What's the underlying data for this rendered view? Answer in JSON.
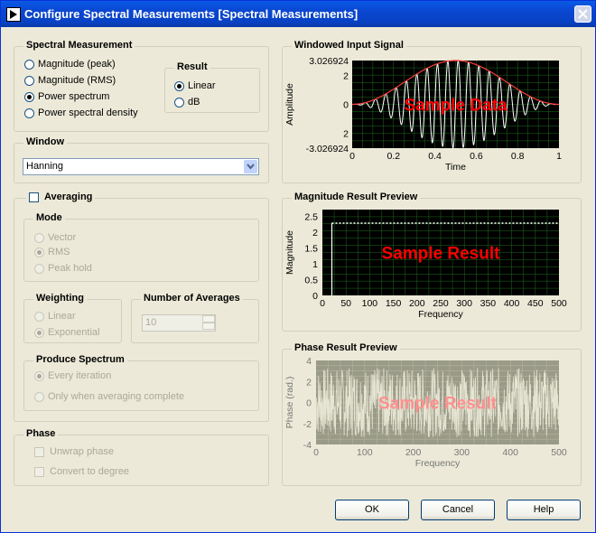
{
  "window": {
    "title": "Configure Spectral Measurements [Spectral Measurements]"
  },
  "spectral_measurement": {
    "label": "Spectral Measurement",
    "options": [
      "Magnitude (peak)",
      "Magnitude (RMS)",
      "Power spectrum",
      "Power spectral density"
    ],
    "selected": "Power spectrum"
  },
  "result": {
    "label": "Result",
    "options": [
      "Linear",
      "dB"
    ],
    "selected": "Linear"
  },
  "window_group": {
    "label": "Window",
    "value": "Hanning"
  },
  "averaging": {
    "label": "Averaging",
    "checked": false,
    "mode": {
      "label": "Mode",
      "options": [
        "Vector",
        "RMS",
        "Peak hold"
      ],
      "selected": "RMS"
    },
    "weighting": {
      "label": "Weighting",
      "options": [
        "Linear",
        "Exponential"
      ],
      "selected": "Exponential"
    },
    "number_of_averages": {
      "label": "Number of Averages",
      "value": "10"
    },
    "produce_spectrum": {
      "label": "Produce Spectrum",
      "options": [
        "Every iteration",
        "Only when averaging complete"
      ],
      "selected": "Every iteration"
    }
  },
  "phase": {
    "label": "Phase",
    "unwrap_label": "Unwrap phase",
    "convert_label": "Convert to degree"
  },
  "buttons": {
    "ok": "OK",
    "cancel": "Cancel",
    "help": "Help"
  },
  "colors": {
    "plot_bg": "#000000",
    "grid": "#1f6b1f",
    "overlay": "#ff0000",
    "envelope": "#ff3b3b",
    "disabled_bg": "#9a9a88"
  },
  "chart_data": [
    {
      "type": "line",
      "title": "Windowed Input Signal",
      "overlay_text": "Sample Data",
      "xlabel": "Time",
      "ylabel": "Amplitude",
      "x_ticks": [
        "0",
        "0.2",
        "0.4",
        "0.6",
        "0.8",
        "1"
      ],
      "y_ticks": [
        "3.026924",
        "2",
        "0",
        "2",
        "-3.026924"
      ],
      "xlim": [
        0,
        1
      ],
      "ylim": [
        -3.026924,
        3.026924
      ],
      "series": [
        {
          "signal": "sine",
          "amplitude": 3.026924,
          "cycles": 20,
          "window": "Hanning"
        }
      ]
    },
    {
      "type": "line",
      "title": "Magnitude Result Preview",
      "overlay_text": "Sample Result",
      "xlabel": "Frequency",
      "ylabel": "Magnitude",
      "x_ticks": [
        "0",
        "50",
        "100",
        "150",
        "200",
        "250",
        "300",
        "350",
        "400",
        "450",
        "500"
      ],
      "y_ticks": [
        "2.5",
        "2",
        "1.5",
        "1",
        "0.5",
        "0"
      ],
      "xlim": [
        0,
        500
      ],
      "ylim": [
        0,
        2.5
      ],
      "series": [
        {
          "peak_x": 20,
          "peak_y": 2.29,
          "dotted_level": 2.29
        }
      ]
    },
    {
      "type": "line",
      "title": "Phase Result Preview",
      "overlay_text": "Sample Result",
      "xlabel": "Frequency",
      "ylabel": "Phase (rad.)",
      "x_ticks": [
        "0",
        "100",
        "200",
        "300",
        "400",
        "500"
      ],
      "y_ticks": [
        "4",
        "2",
        "0",
        "-2",
        "-4"
      ],
      "xlim": [
        0,
        500
      ],
      "ylim": [
        -4,
        4
      ],
      "disabled": true
    }
  ]
}
